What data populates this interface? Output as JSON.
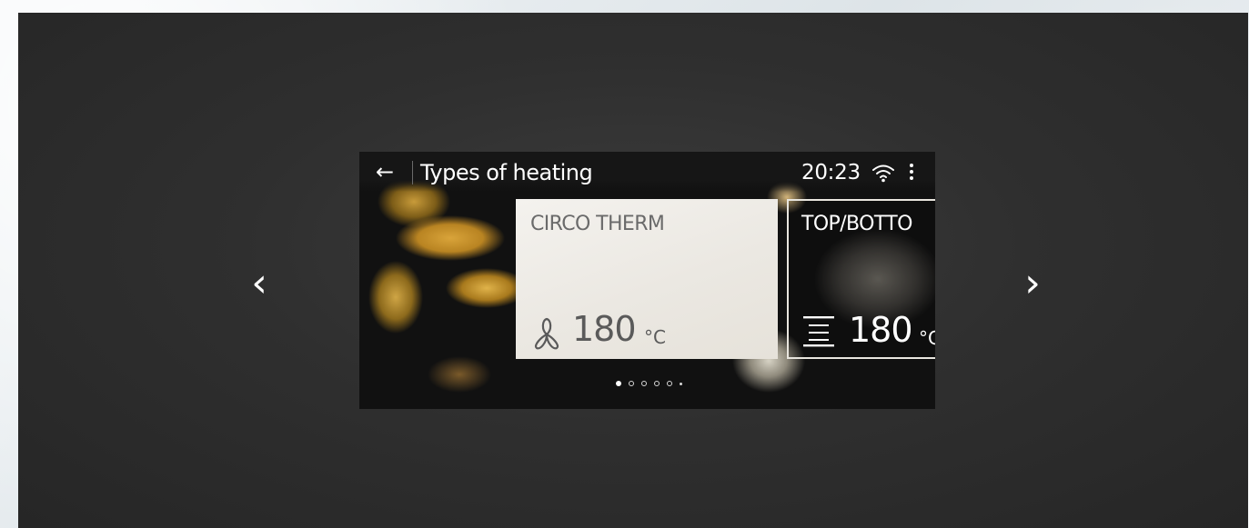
{
  "carousel": {
    "prev_arrow": "‹",
    "next_arrow": "›"
  },
  "screen": {
    "title": "Types of heating",
    "time": "20:23",
    "icons": {
      "back": "back-arrow-icon",
      "wifi": "wifi-icon",
      "menu": "more-vertical-icon"
    },
    "active_mode": {
      "name": "CIRCO THERM",
      "temperature": "180",
      "unit": "°C",
      "icon": "fan-icon"
    },
    "next_mode": {
      "name": "TOP/BOTTO",
      "temperature": "180",
      "unit": "°C",
      "icon": "top-bottom-heat-icon"
    },
    "pager": {
      "active_index": 0,
      "count": 6
    }
  },
  "colors": {
    "stage_bg": "#2f2f2f",
    "screen_bg": "#161616",
    "card_bg": "#efece6",
    "text_light": "#ffffff",
    "text_dark": "#5a5a5a"
  }
}
